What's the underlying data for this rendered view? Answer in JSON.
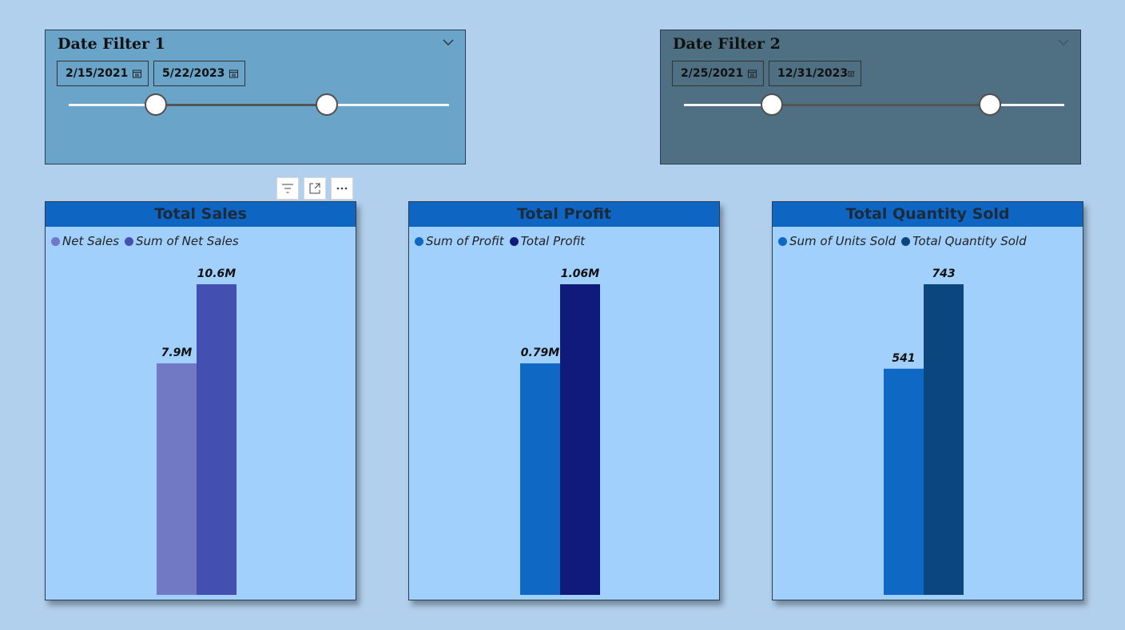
{
  "filters": [
    {
      "title": "Date Filter 1",
      "start": "2/15/2021",
      "end": "5/22/2023",
      "start_frac": 0.23,
      "end_frac": 0.678,
      "bg": "#6aa4c8"
    },
    {
      "title": "Date Filter 2",
      "start": "2/25/2021",
      "end": "12/31/2023",
      "start_frac": 0.232,
      "end_frac": 0.804,
      "bg": "#4f6f82"
    }
  ],
  "toolbar": {
    "icons": [
      "filter-icon",
      "focus-mode-icon",
      "more-options-icon"
    ]
  },
  "chart_data": [
    {
      "type": "bar",
      "title": "Total Sales",
      "series": [
        {
          "name": "Net Sales",
          "values": [
            7.9
          ],
          "label": "7.9M",
          "color": "#7178c4"
        },
        {
          "name": "Sum of Net Sales",
          "values": [
            10.6
          ],
          "label": "10.6M",
          "color": "#434fb1"
        }
      ],
      "unit": "M",
      "ylim": [
        0,
        10.6
      ]
    },
    {
      "type": "bar",
      "title": "Total Profit",
      "series": [
        {
          "name": "Sum of Profit",
          "values": [
            0.79
          ],
          "label": "0.79M",
          "color": "#0f68c3"
        },
        {
          "name": "Total Profit",
          "values": [
            1.06
          ],
          "label": "1.06M",
          "color": "#0f1a7b"
        }
      ],
      "unit": "M",
      "ylim": [
        0,
        1.06
      ]
    },
    {
      "type": "bar",
      "title": "Total Quantity Sold",
      "series": [
        {
          "name": "Sum of Units Sold",
          "values": [
            541
          ],
          "label": "541",
          "color": "#0f68c3"
        },
        {
          "name": "Total Quantity Sold",
          "values": [
            743
          ],
          "label": "743",
          "color": "#0c467f"
        }
      ],
      "ylim": [
        0,
        743
      ]
    }
  ]
}
